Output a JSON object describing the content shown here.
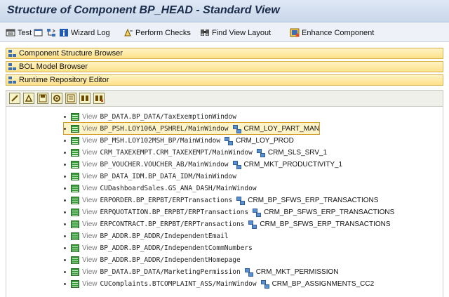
{
  "title": "Structure of Component BP_HEAD - Standard View",
  "toolbar": {
    "test": "Test",
    "wizard_log": "Wizard Log",
    "perform_checks": "Perform Checks",
    "find_view_layout": "Find View Layout",
    "enhance_component": "Enhance Component"
  },
  "panels": {
    "component_structure": "Component Structure Browser",
    "bol_model": "BOL Model Browser",
    "runtime_repository": "Runtime Repository Editor"
  },
  "tree": {
    "rows": [
      {
        "type": "View",
        "name": "BP_DATA.BP_DATA/TaxExemptionWindow",
        "component": ""
      },
      {
        "type": "View",
        "name": "BP_PSH.LOY106A_PSHREL/MainWindow",
        "component": "CRM_LOY_PART_MAN"
      },
      {
        "type": "View",
        "name": "BP_MSH.LOY102MSH_BP/MainWindow",
        "component": "CRM_LOY_PROD"
      },
      {
        "type": "View",
        "name": "CRM_TAXEXEMPT.CRM_TAXEXEMPT/MainWindow",
        "component": "CRM_SLS_SRV_1"
      },
      {
        "type": "View",
        "name": "BP_VOUCHER.VOUCHER_AB/MainWindow",
        "component": "CRM_MKT_PRODUCTIVITY_1"
      },
      {
        "type": "View",
        "name": "BP_DATA_IDM.BP_DATA_IDM/MainWindow",
        "component": ""
      },
      {
        "type": "View",
        "name": "CUDashboardSales.GS_ANA_DASH/MainWindow",
        "component": ""
      },
      {
        "type": "View",
        "name": "ERPORDER.BP_ERPBT/ERPTransactions",
        "component": "CRM_BP_SFWS_ERP_TRANSACTIONS"
      },
      {
        "type": "View",
        "name": "ERPQUOTATION.BP_ERPBT/ERPTransactions",
        "component": "CRM_BP_SFWS_ERP_TRANSACTIONS"
      },
      {
        "type": "View",
        "name": "ERPCONTRACT.BP_ERPBT/ERPTransactions",
        "component": "CRM_BP_SFWS_ERP_TRANSACTIONS"
      },
      {
        "type": "View",
        "name": "BP_ADDR.BP_ADDR/IndependentEmail",
        "component": ""
      },
      {
        "type": "View",
        "name": "BP_ADDR.BP_ADDR/IndependentCommNumbers",
        "component": ""
      },
      {
        "type": "View",
        "name": "BP_ADDR.BP_ADDR/IndependentHomepage",
        "component": ""
      },
      {
        "type": "View",
        "name": "BP_DATA.BP_DATA/MarketingPermission",
        "component": "CRM_MKT_PERMISSION"
      },
      {
        "type": "View",
        "name": "CUComplaints.BTCOMPLAINT_ASS/MainWindow",
        "component": "CRM_BP_ASSIGNMENTS_CC2"
      }
    ]
  }
}
